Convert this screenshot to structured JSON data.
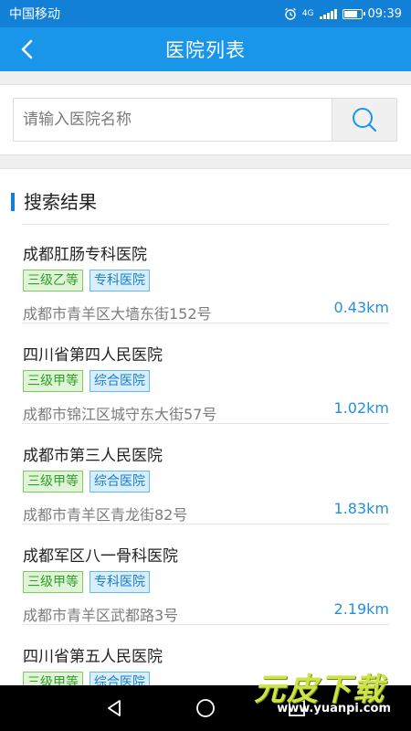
{
  "status_bar": {
    "carrier": "中国移动",
    "network": "4G",
    "time": "09:39"
  },
  "nav": {
    "title": "医院列表"
  },
  "search": {
    "placeholder": "请输入医院名称"
  },
  "results": {
    "heading": "搜索结果",
    "items": [
      {
        "name": "成都肛肠专科医院",
        "tags": [
          "三级乙等",
          "专科医院"
        ],
        "address": "成都市青羊区大墙东街152号",
        "distance": "0.43km"
      },
      {
        "name": "四川省第四人民医院",
        "tags": [
          "三级甲等",
          "综合医院"
        ],
        "address": "成都市锦江区城守东大街57号",
        "distance": "1.02km"
      },
      {
        "name": "成都市第三人民医院",
        "tags": [
          "三级甲等",
          "综合医院"
        ],
        "address": "成都市青羊区青龙街82号",
        "distance": "1.83km"
      },
      {
        "name": "成都军区八一骨科医院",
        "tags": [
          "三级甲等",
          "专科医院"
        ],
        "address": "成都市青羊区武都路3号",
        "distance": "2.19km"
      },
      {
        "name": "四川省第五人民医院",
        "tags": [
          "三级甲等",
          "综合医院"
        ],
        "address": "",
        "distance": ""
      }
    ]
  },
  "watermark": {
    "title": "元皮下载",
    "url": "www.yuanpi.com"
  },
  "colors": {
    "status_bar": "#1380d8",
    "nav_bar": "#1996ea",
    "tag_grade": "#2f9e2a",
    "tag_type": "#1d7ec9",
    "distance": "#2590d9"
  },
  "icons": {
    "back": "chevron-left-icon",
    "search": "magnifier-icon",
    "nav_back": "triangle-back-icon",
    "nav_home": "circle-home-icon",
    "nav_recent": "square-recent-icon"
  }
}
